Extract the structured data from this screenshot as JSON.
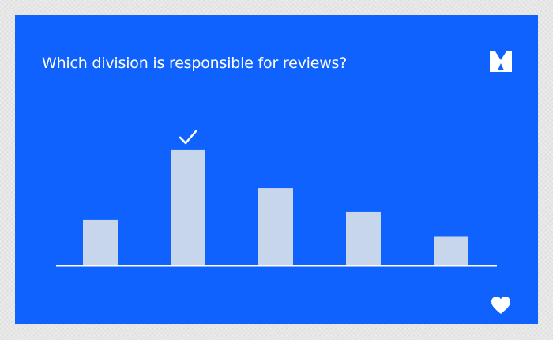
{
  "card": {
    "background_color": "#1062fe",
    "question": "Which division is responsible for reviews?",
    "logo_icon": "mentimeter-logo-icon",
    "like_icon": "heart-icon"
  },
  "chart_data": {
    "type": "bar",
    "categories": [
      "",
      "",
      "",
      "",
      ""
    ],
    "values": [
      35,
      88,
      59,
      41,
      22
    ],
    "ylim": [
      0,
      100
    ],
    "correct_index": 1,
    "correct_marker_icon": "checkmark-icon",
    "bar_color": "#c8d6ec",
    "axis_color": "#ffffff"
  }
}
